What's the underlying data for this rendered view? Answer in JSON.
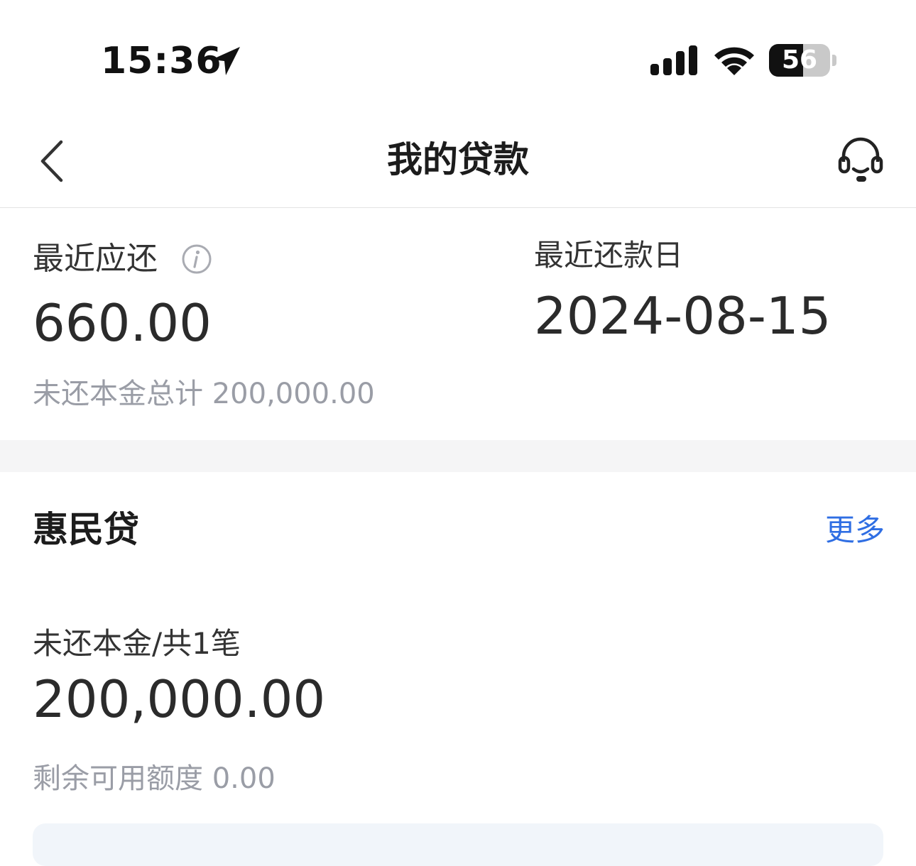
{
  "status_bar": {
    "time": "15:36",
    "battery_level": "56",
    "icons": [
      "location-arrow-icon",
      "cellular-signal-icon",
      "wifi-icon",
      "battery-icon"
    ]
  },
  "nav": {
    "title": "我的贷款",
    "back_icon": "chevron-left-icon",
    "service_icon": "headset-icon"
  },
  "summary": {
    "recent_due_label": "最近应还",
    "recent_due_amount": "660.00",
    "recent_date_label": "最近还款日",
    "recent_date_value": "2024-08-15",
    "principal_total_label": "未还本金总计",
    "principal_total_value": "200,000.00",
    "info_icon": "info-icon"
  },
  "loan": {
    "name": "惠民贷",
    "more": "更多",
    "unpaid_label": "未还本金/共1笔",
    "unpaid_amount": "200,000.00",
    "remaining_label": "剩余可用额度",
    "remaining_value": "0.00"
  },
  "colors": {
    "accent": "#2f6ee3",
    "muted_text": "#9a9da6",
    "section_gap": "#f5f5f6",
    "panel_bg": "#f1f5fa"
  }
}
